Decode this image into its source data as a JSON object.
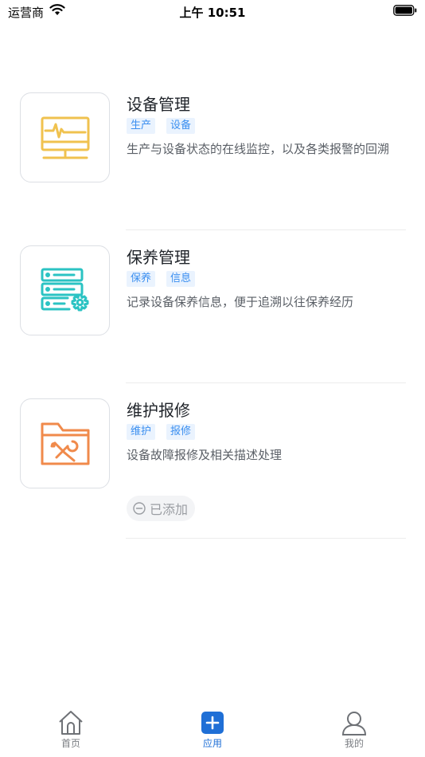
{
  "status_bar": {
    "carrier": "运营商",
    "time": "上午 10:51"
  },
  "apps": [
    {
      "title": "设备管理",
      "tags": [
        "生产",
        "设备"
      ],
      "description": "生产与设备状态的在线监控，以及各类报警的回溯",
      "icon": "monitor-pulse-icon",
      "color": "#f0c24f"
    },
    {
      "title": "保养管理",
      "tags": [
        "保养",
        "信息"
      ],
      "description": "记录设备保养信息，便于追溯以往保养经历",
      "icon": "server-gear-icon",
      "color": "#2bc3c3"
    },
    {
      "title": "维护报修",
      "tags": [
        "维护",
        "报修"
      ],
      "description": "设备故障报修及相关描述处理",
      "icon": "folder-tools-icon",
      "color": "#f08a4b",
      "added_label": "已添加"
    }
  ],
  "tab_bar": {
    "items": [
      {
        "label": "首页",
        "icon": "home-icon"
      },
      {
        "label": "应用",
        "icon": "plus-square-icon",
        "active": true
      },
      {
        "label": "我的",
        "icon": "user-icon"
      }
    ],
    "active_color": "#1f6fd6"
  }
}
